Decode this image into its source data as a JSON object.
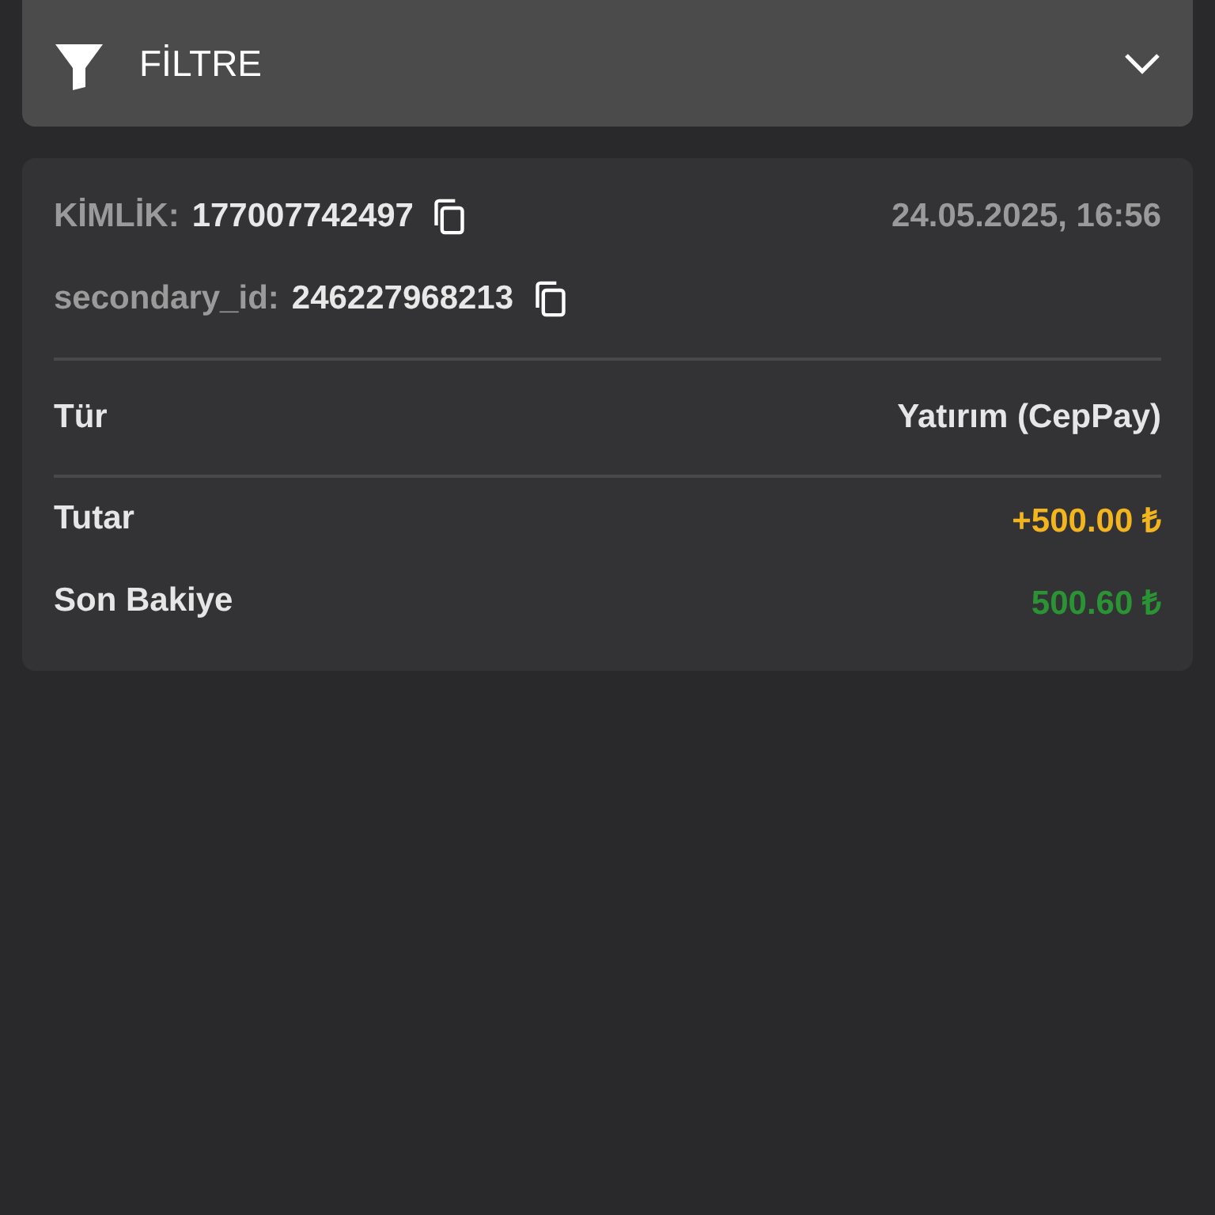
{
  "filter": {
    "label": "FİLTRE",
    "expanded": false
  },
  "transaction": {
    "ids": [
      {
        "label": "KİMLİK:",
        "value": "177007742497"
      },
      {
        "label": "secondary_id:",
        "value": "246227968213"
      }
    ],
    "date": "24.05.2025, 16:56",
    "type": {
      "label": "Tür",
      "value": "Yatırım (CepPay)"
    },
    "amounts": [
      {
        "label": "Tutar",
        "value": "+500.00 ₺",
        "color": "#f2b41f"
      },
      {
        "label": "Son Bakiye",
        "value": "500.60 ₺",
        "color": "#2a9434"
      }
    ]
  }
}
